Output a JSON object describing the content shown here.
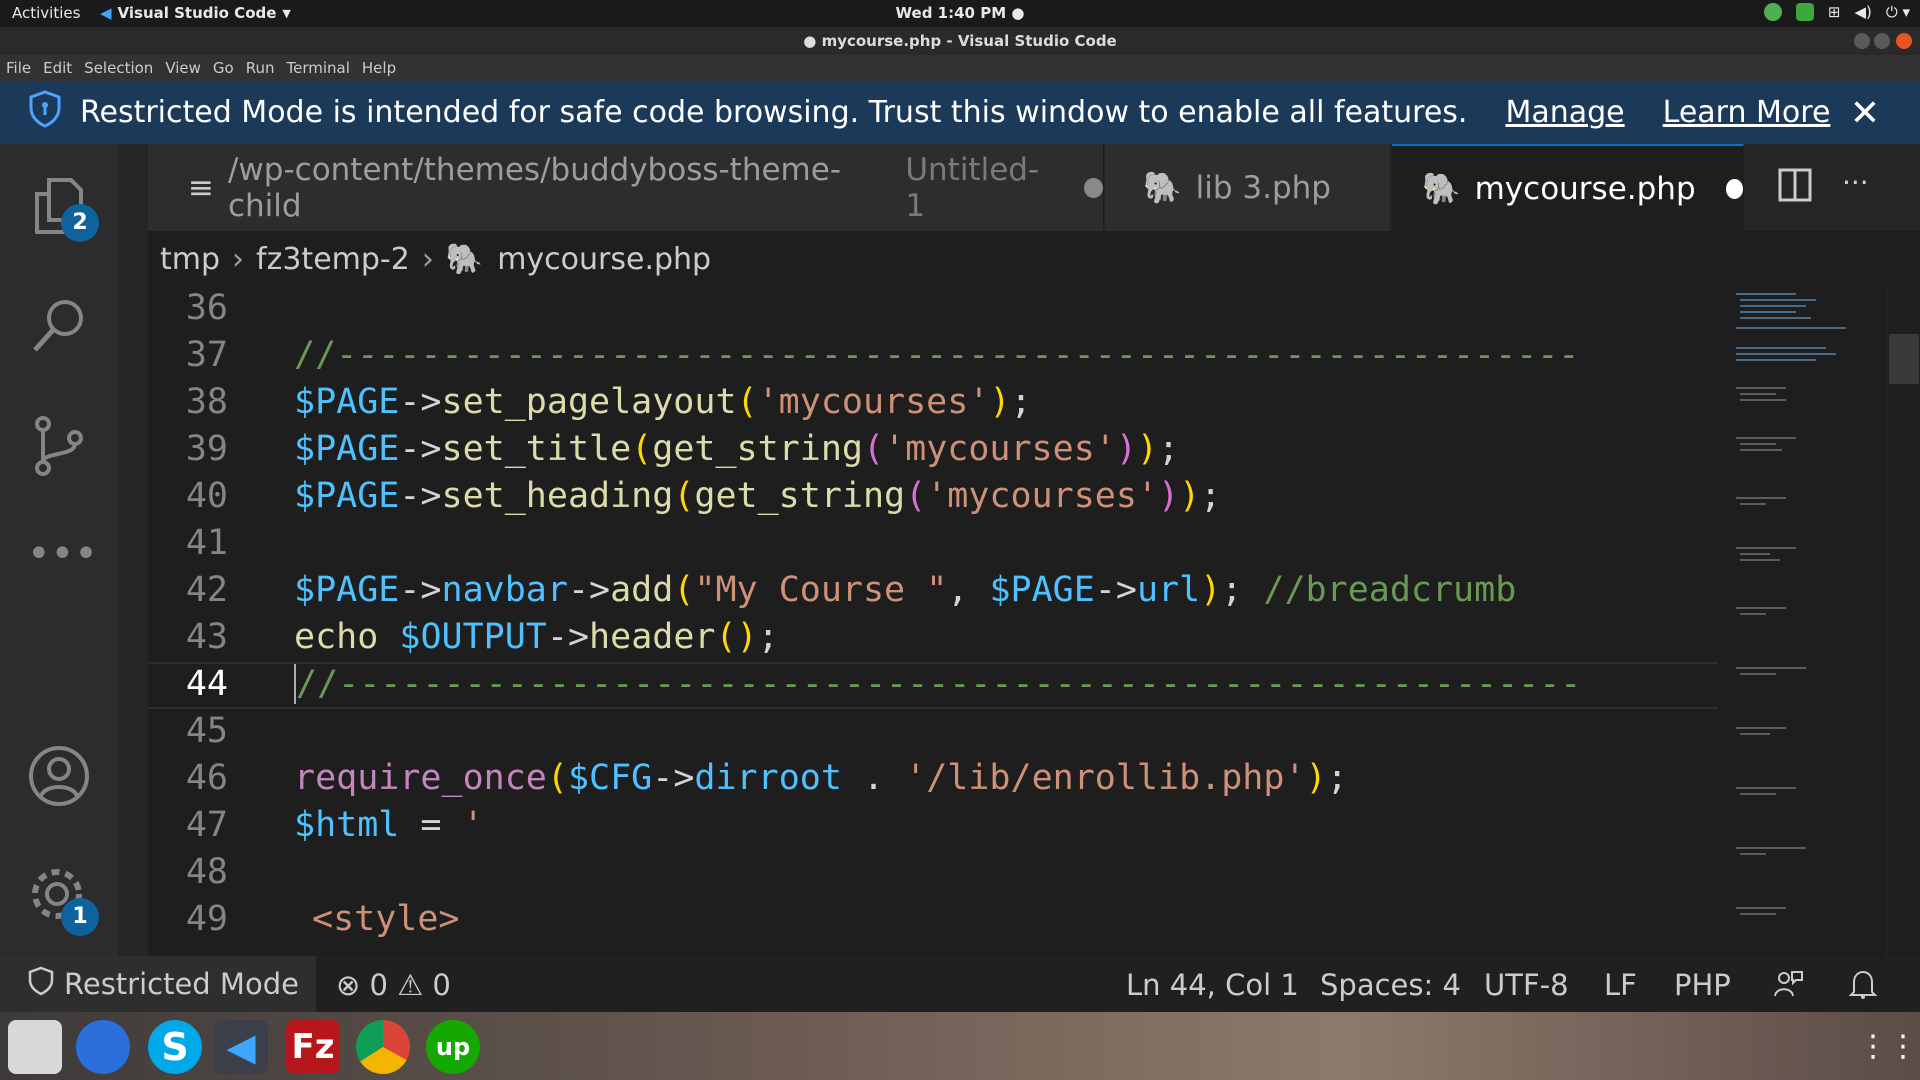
{
  "topbar": {
    "activities": "Activities",
    "app_name": "Visual Studio Code",
    "clock": "Wed  1:40 PM"
  },
  "window": {
    "title": "mycourse.php - Visual Studio Code"
  },
  "menu": [
    "File",
    "Edit",
    "Selection",
    "View",
    "Go",
    "Run",
    "Terminal",
    "Help"
  ],
  "banner": {
    "message": "Restricted Mode is intended for safe code browsing. Trust this window to enable all features.",
    "manage": "Manage",
    "learn_more": "Learn More"
  },
  "activity": {
    "explorer_badge": "2",
    "settings_badge": "1"
  },
  "tabs": [
    {
      "path": "/wp-content/themes/buddyboss-theme-child",
      "label": "Untitled-1"
    },
    {
      "label": "lib 3.php"
    },
    {
      "label": "mycourse.php"
    }
  ],
  "breadcrumb": {
    "part1": "tmp",
    "part2": "fz3temp-2",
    "file": "mycourse.php"
  },
  "editor": {
    "line_numbers": [
      "36",
      "37",
      "38",
      "39",
      "40",
      "41",
      "42",
      "43",
      "44",
      "45",
      "46",
      "47",
      "48",
      "49"
    ]
  },
  "status": {
    "restricted": "Restricted Mode",
    "errors": "0",
    "warnings": "0",
    "position": "Ln 44, Col 1",
    "spaces": "Spaces: 4",
    "encoding": "UTF-8",
    "eol": "LF",
    "language": "PHP"
  },
  "colors": {
    "accent": "#0e70c0",
    "banner": "#1b3a5a",
    "badge": "#0e639c"
  }
}
